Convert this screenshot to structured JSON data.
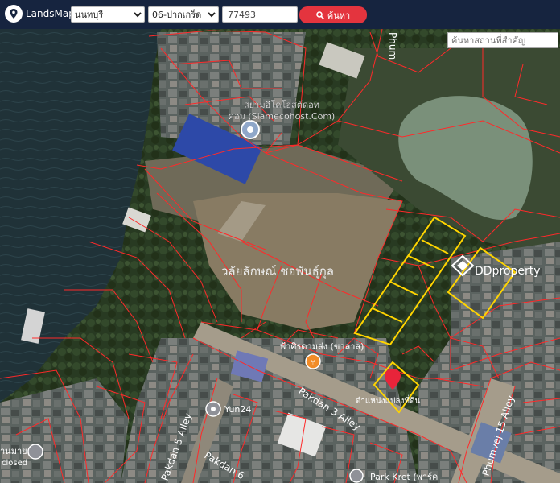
{
  "toolbar": {
    "brand": "LandsMaps",
    "province": "นนทบุรี",
    "district": "06-ปากเกร็ด",
    "deed_number": "77493",
    "search_label": "ค้นหา"
  },
  "landmark_search": {
    "placeholder": "ค้นหาสถานที่สำคัญ"
  },
  "map": {
    "labels": {
      "siamecohost_th": "สยามอีโคโฮสต์ดอท",
      "siamecohost_en": "คอม (Siamecohost.Com)",
      "parcel_owner": "วลัยลักษณ์ ชอพันธุ์กุล",
      "shop": "ฟ้าศิรดามส่ง (ขาลาล)",
      "parcel_marker": "ตำแหน่งแปลงที่ดิน",
      "yun24": "Yun24",
      "road_pakdan3": "Pakdan 3 Alley",
      "road_pakdan5": "Pakdan 5 Alley",
      "road_pakdan6": "Pakdan 6",
      "road_phumvej": "Phumvej 15 Alley",
      "road_phum": "Phum",
      "park_kret": "Park Kret (พาร์ค",
      "corner_name": "านมาย",
      "corner_status": "closed"
    },
    "watermark": "DDproperty",
    "colors": {
      "parcel_line": "#ff2a2a",
      "highlight": "#ffd400",
      "pin": "#e8243a",
      "toolbar": "#16243f"
    }
  }
}
